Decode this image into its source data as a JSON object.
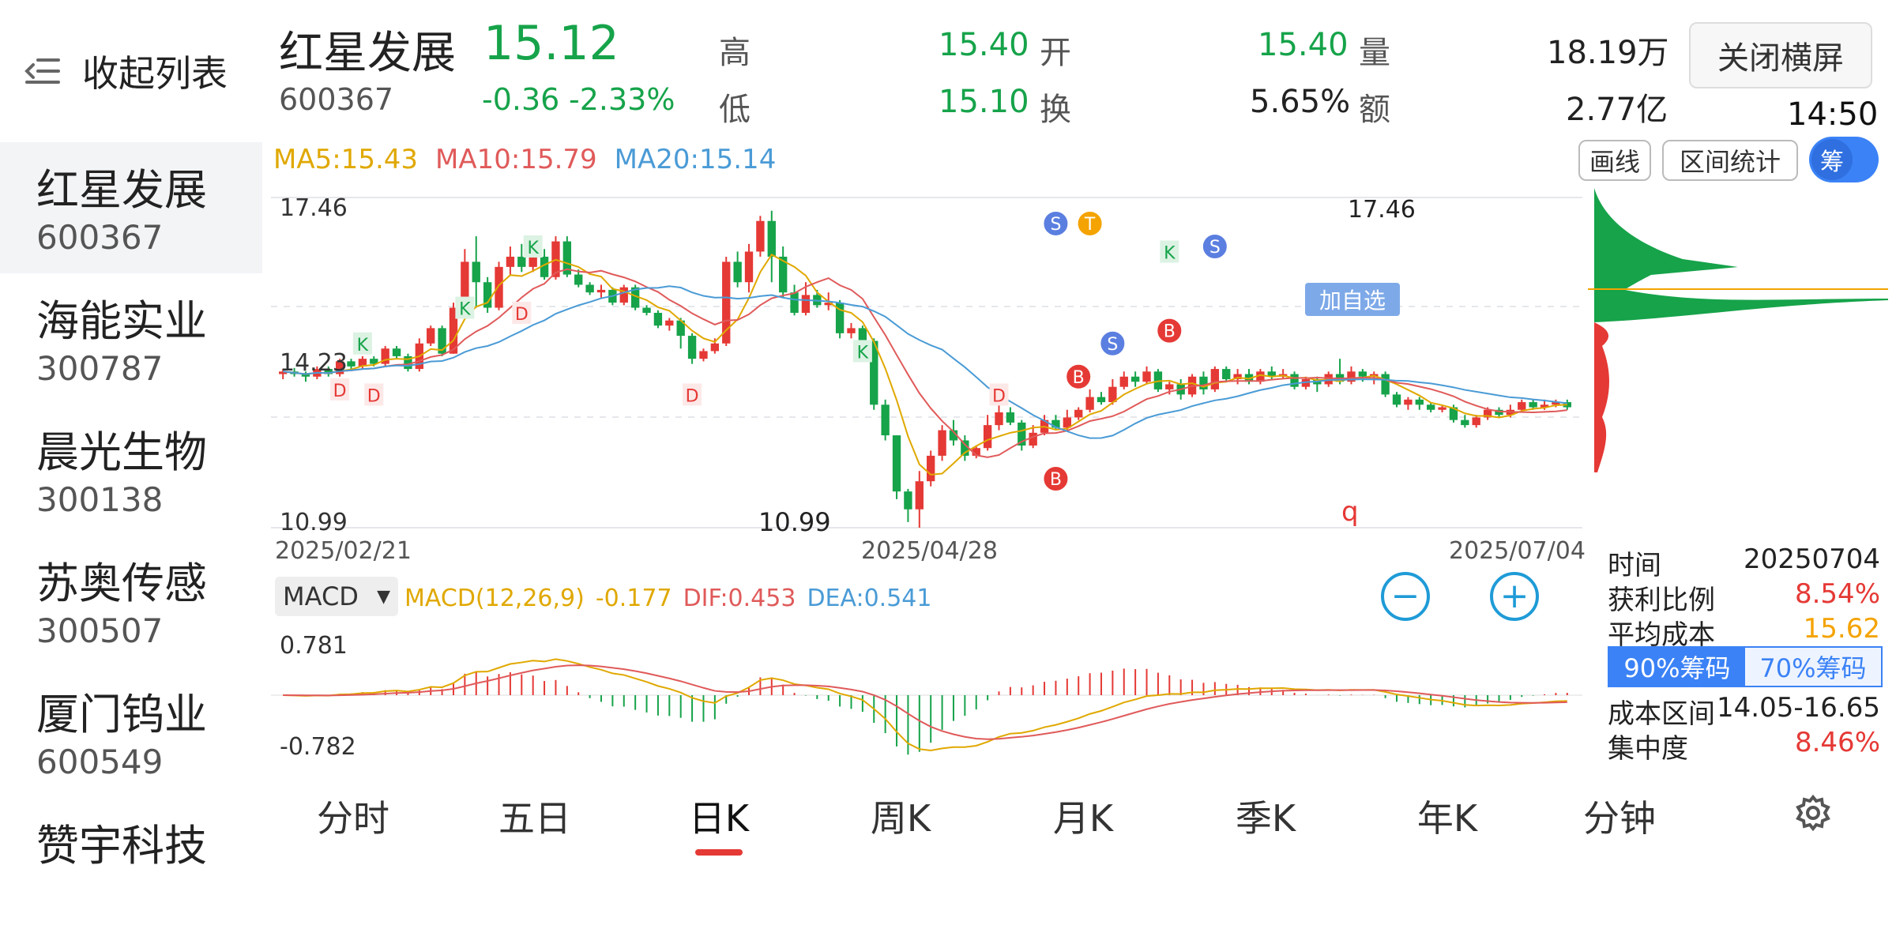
{
  "sidebar": {
    "collapse_label": "收起列表",
    "items": [
      {
        "name": "红星发展",
        "code": "600367"
      },
      {
        "name": "海能实业",
        "code": "300787"
      },
      {
        "name": "晨光生物",
        "code": "300138"
      },
      {
        "name": "苏奥传感",
        "code": "300507"
      },
      {
        "name": "厦门钨业",
        "code": "600549"
      },
      {
        "name": "赞宇科技",
        "code": ""
      }
    ]
  },
  "header": {
    "name": "红星发展",
    "code": "600367",
    "price": "15.12",
    "change": "-0.36",
    "change_pct": "-2.33%",
    "high_label": "高",
    "high": "15.40",
    "low_label": "低",
    "low": "15.10",
    "open_label": "开",
    "open": "15.40",
    "turnover_label": "换",
    "turnover": "5.65%",
    "volume_label": "量",
    "volume": "18.19万",
    "amount_label": "额",
    "amount": "2.77亿",
    "close_landscape": "关闭横屏",
    "time": "14:50"
  },
  "ma": {
    "ma5": "MA5:15.43",
    "ma10": "MA10:15.79",
    "ma20": "MA20:15.14"
  },
  "tools": {
    "draw_line": "画线",
    "range_stats": "区间统计",
    "chip_toggle": "筹"
  },
  "kline": {
    "y_top": "17.46",
    "y_mid": "14.23",
    "y_bottom": "10.99",
    "dates": [
      "2025/02/21",
      "2025/04/28",
      "2025/07/04"
    ],
    "max_label": "17.46",
    "min_label": "10.99",
    "add_watch": "加自选",
    "q_label": "q",
    "markers": {
      "k": "K",
      "d": "D",
      "b": "B",
      "s": "S",
      "t": "T"
    }
  },
  "macd": {
    "select": "MACD",
    "params": "MACD(12,26,9)",
    "value": "-0.177",
    "dif": "DIF:0.453",
    "dea": "DEA:0.541",
    "y_top": "0.781",
    "y_bottom": "-0.782"
  },
  "chips": {
    "time_label": "时间",
    "time": "20250704",
    "profit_label": "获利比例",
    "profit": "8.54%",
    "avg_cost_label": "平均成本",
    "avg_cost": "15.62",
    "tab_90": "90%筹码",
    "tab_70": "70%筹码",
    "cost_range_label": "成本区间",
    "cost_range": "14.05-16.65",
    "concentration_label": "集中度",
    "concentration": "8.46%"
  },
  "tabs": [
    "分时",
    "五日",
    "日K",
    "周K",
    "月K",
    "季K",
    "年K",
    "分钟"
  ],
  "colors": {
    "up": "#e53935",
    "down": "#16a34a",
    "ma5": "#e0a800",
    "ma10": "#e05a5a",
    "ma20": "#4a9bd6",
    "accent": "#3b82f6"
  },
  "chart_data": {
    "type": "candlestick",
    "y_range": [
      10.99,
      17.46
    ],
    "candles": [
      [
        14.0,
        14.05,
        13.9,
        14.1
      ],
      [
        14.05,
        14.0,
        13.95,
        14.12
      ],
      [
        14.0,
        13.95,
        13.85,
        14.05
      ],
      [
        13.95,
        14.1,
        13.9,
        14.15
      ],
      [
        14.1,
        14.0,
        13.95,
        14.15
      ],
      [
        14.0,
        14.25,
        13.95,
        14.3
      ],
      [
        14.25,
        14.15,
        14.1,
        14.3
      ],
      [
        14.15,
        14.3,
        14.1,
        14.35
      ],
      [
        14.3,
        14.2,
        14.15,
        14.35
      ],
      [
        14.2,
        14.5,
        14.15,
        14.55
      ],
      [
        14.5,
        14.35,
        14.3,
        14.55
      ],
      [
        14.35,
        14.1,
        14.05,
        14.4
      ],
      [
        14.1,
        14.6,
        14.05,
        14.7
      ],
      [
        14.6,
        14.9,
        14.55,
        14.95
      ],
      [
        14.9,
        14.4,
        14.35,
        14.95
      ],
      [
        14.4,
        15.3,
        14.4,
        15.4
      ],
      [
        15.3,
        16.2,
        15.3,
        16.45
      ],
      [
        16.2,
        15.8,
        15.3,
        16.7
      ],
      [
        15.8,
        15.3,
        15.2,
        15.9
      ],
      [
        15.3,
        16.1,
        15.25,
        16.2
      ],
      [
        16.1,
        16.3,
        15.95,
        16.5
      ],
      [
        16.3,
        16.1,
        16.0,
        16.55
      ],
      [
        16.1,
        16.3,
        16.0,
        16.45
      ],
      [
        16.3,
        15.9,
        15.85,
        16.45
      ],
      [
        15.9,
        16.6,
        15.85,
        16.7
      ],
      [
        16.6,
        15.95,
        15.9,
        16.7
      ],
      [
        15.95,
        15.75,
        15.7,
        16.05
      ],
      [
        15.75,
        15.6,
        15.55,
        15.8
      ],
      [
        15.6,
        15.65,
        15.5,
        15.75
      ],
      [
        15.65,
        15.4,
        15.35,
        15.7
      ],
      [
        15.4,
        15.7,
        15.35,
        15.75
      ],
      [
        15.7,
        15.3,
        15.25,
        15.75
      ],
      [
        15.3,
        15.2,
        15.15,
        15.35
      ],
      [
        15.2,
        14.95,
        14.9,
        15.25
      ],
      [
        14.95,
        15.05,
        14.85,
        15.1
      ],
      [
        15.05,
        14.75,
        14.5,
        15.1
      ],
      [
        14.75,
        14.3,
        14.2,
        14.8
      ],
      [
        14.3,
        14.45,
        14.25,
        14.5
      ],
      [
        14.45,
        14.6,
        14.4,
        14.7
      ],
      [
        14.6,
        16.2,
        14.55,
        16.3
      ],
      [
        16.2,
        15.8,
        15.7,
        16.4
      ],
      [
        15.8,
        16.4,
        15.6,
        16.55
      ],
      [
        16.4,
        17.0,
        16.3,
        17.1
      ],
      [
        17.0,
        16.3,
        15.8,
        17.2
      ],
      [
        16.3,
        15.6,
        15.5,
        16.5
      ],
      [
        15.6,
        15.2,
        15.15,
        15.75
      ],
      [
        15.2,
        15.55,
        15.15,
        15.8
      ],
      [
        15.55,
        15.35,
        15.3,
        15.65
      ],
      [
        15.35,
        15.4,
        15.25,
        15.6
      ],
      [
        15.4,
        14.8,
        14.7,
        15.45
      ],
      [
        14.8,
        14.9,
        14.7,
        15.0
      ],
      [
        14.9,
        14.65,
        14.5,
        14.95
      ],
      [
        14.65,
        13.4,
        13.3,
        14.7
      ],
      [
        13.4,
        12.8,
        12.7,
        13.5
      ],
      [
        12.8,
        11.7,
        11.55,
        12.8
      ],
      [
        11.7,
        11.35,
        11.1,
        11.75
      ],
      [
        11.35,
        11.9,
        10.99,
        12.1
      ],
      [
        11.9,
        12.4,
        11.8,
        12.5
      ],
      [
        12.4,
        12.9,
        12.3,
        13.0
      ],
      [
        12.9,
        12.7,
        12.6,
        13.1
      ],
      [
        12.7,
        12.4,
        12.3,
        12.8
      ],
      [
        12.4,
        12.55,
        12.35,
        12.6
      ],
      [
        12.55,
        13.0,
        12.5,
        13.2
      ],
      [
        13.0,
        13.25,
        12.9,
        13.6
      ],
      [
        13.25,
        13.05,
        13.0,
        13.35
      ],
      [
        13.05,
        12.6,
        12.5,
        13.1
      ],
      [
        12.6,
        12.85,
        12.55,
        13.0
      ],
      [
        12.85,
        13.1,
        12.8,
        13.2
      ],
      [
        13.1,
        12.95,
        12.9,
        13.2
      ],
      [
        12.95,
        13.15,
        12.9,
        13.3
      ],
      [
        13.15,
        13.3,
        13.1,
        13.35
      ],
      [
        13.3,
        13.55,
        13.25,
        13.7
      ],
      [
        13.55,
        13.45,
        13.4,
        13.65
      ],
      [
        13.45,
        13.75,
        13.4,
        13.9
      ],
      [
        13.75,
        13.95,
        13.7,
        14.05
      ],
      [
        13.95,
        13.85,
        13.75,
        14.05
      ],
      [
        13.85,
        14.05,
        13.8,
        14.15
      ],
      [
        14.05,
        13.7,
        13.65,
        14.1
      ],
      [
        13.7,
        13.8,
        13.6,
        13.85
      ],
      [
        13.8,
        13.6,
        13.5,
        13.9
      ],
      [
        13.6,
        13.95,
        13.55,
        14.0
      ],
      [
        13.95,
        13.7,
        13.6,
        14.05
      ],
      [
        13.7,
        14.1,
        13.65,
        14.15
      ],
      [
        14.1,
        13.9,
        13.85,
        14.15
      ],
      [
        13.9,
        14.0,
        13.8,
        14.1
      ],
      [
        14.0,
        13.85,
        13.8,
        14.1
      ],
      [
        13.85,
        14.05,
        13.8,
        14.1
      ],
      [
        14.05,
        13.95,
        13.9,
        14.15
      ],
      [
        13.95,
        14.0,
        13.9,
        14.1
      ],
      [
        14.0,
        13.75,
        13.7,
        14.05
      ],
      [
        13.75,
        13.9,
        13.7,
        13.95
      ],
      [
        13.9,
        13.8,
        13.65,
        13.95
      ],
      [
        13.8,
        14.0,
        13.75,
        14.05
      ],
      [
        14.0,
        13.85,
        13.8,
        14.3
      ],
      [
        13.85,
        14.05,
        13.8,
        14.15
      ],
      [
        14.05,
        13.95,
        13.85,
        14.1
      ],
      [
        13.95,
        14.0,
        13.8,
        14.05
      ],
      [
        14.0,
        13.6,
        13.55,
        14.05
      ],
      [
        13.6,
        13.4,
        13.35,
        13.65
      ],
      [
        13.4,
        13.5,
        13.3,
        13.55
      ],
      [
        13.5,
        13.4,
        13.3,
        13.55
      ],
      [
        13.4,
        13.3,
        13.25,
        13.45
      ],
      [
        13.3,
        13.35,
        13.25,
        13.4
      ],
      [
        13.35,
        13.1,
        13.05,
        13.4
      ],
      [
        13.1,
        13.0,
        12.95,
        13.2
      ],
      [
        13.0,
        13.15,
        12.95,
        13.2
      ],
      [
        13.15,
        13.3,
        13.1,
        13.35
      ],
      [
        13.3,
        13.2,
        13.15,
        13.35
      ],
      [
        13.2,
        13.3,
        13.15,
        13.4
      ],
      [
        13.3,
        13.45,
        13.25,
        13.5
      ],
      [
        13.45,
        13.35,
        13.3,
        13.5
      ],
      [
        13.35,
        13.4,
        13.3,
        13.5
      ],
      [
        13.4,
        13.45,
        13.35,
        13.5
      ],
      [
        13.45,
        13.35,
        13.3,
        13.5
      ]
    ]
  }
}
